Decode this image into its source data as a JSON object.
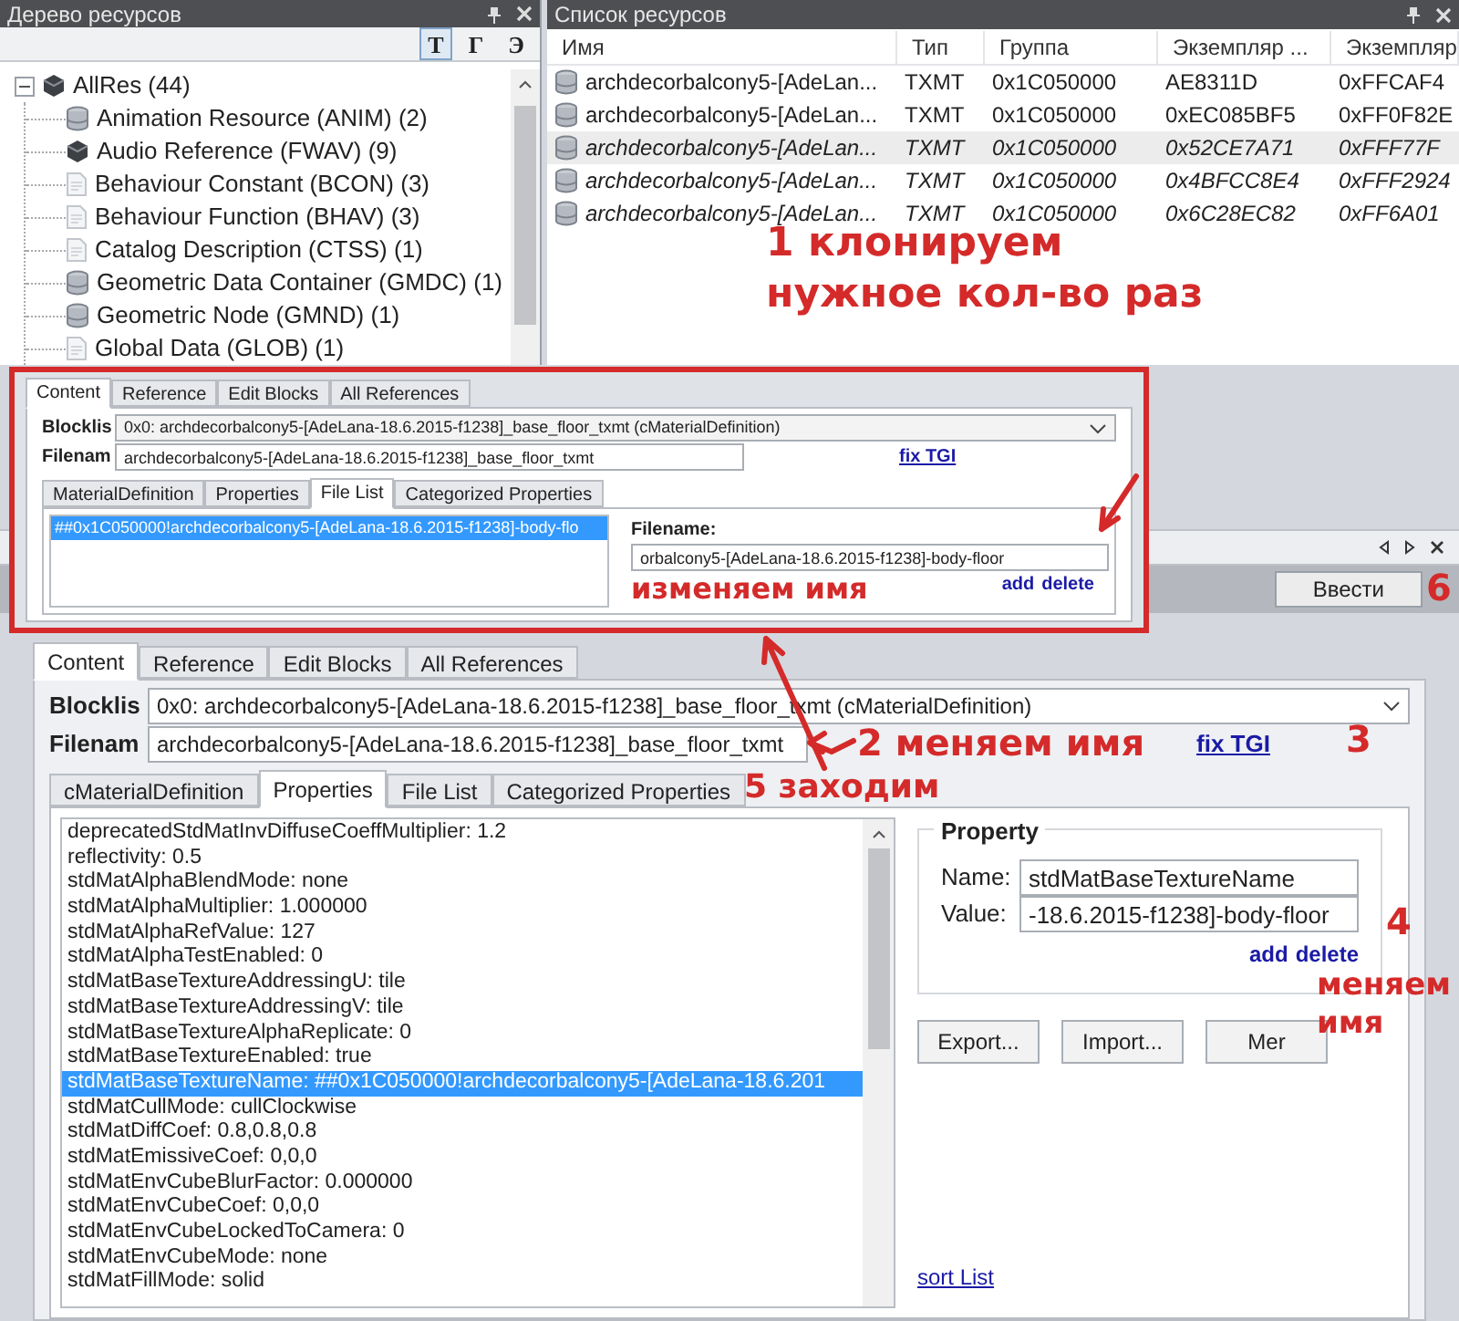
{
  "resource_tree": {
    "title": "Дерево ресурсов",
    "toolbar": [
      {
        "label": "Т",
        "selected": true
      },
      {
        "label": "Г",
        "selected": false
      },
      {
        "label": "Э",
        "selected": false
      }
    ],
    "items": [
      {
        "label": "AllRes (44)",
        "kind": "cube",
        "expanded": true,
        "children": [
          {
            "label": "Animation Resource (ANIM) (2)",
            "kind": "database"
          },
          {
            "label": "Audio Reference (FWAV) (9)",
            "kind": "cube"
          },
          {
            "label": "Behaviour Constant (BCON) (3)",
            "kind": "document"
          },
          {
            "label": "Behaviour Function (BHAV) (3)",
            "kind": "document"
          },
          {
            "label": "Catalog Description (CTSS) (1)",
            "kind": "document"
          },
          {
            "label": "Geometric Data Container (GMDC) (1)",
            "kind": "database"
          },
          {
            "label": "Geometric Node (GMND) (1)",
            "kind": "database"
          },
          {
            "label": "Global Data (GLOB) (1)",
            "kind": "document"
          }
        ]
      }
    ]
  },
  "resource_list": {
    "title": "Список ресурсов",
    "columns": [
      "Имя",
      "Тип",
      "Группа",
      "Экземпляр ...",
      "Экземпляр"
    ],
    "rows": [
      {
        "cells": [
          "archdecorbalcony5-[AdeLan...",
          "TXMT",
          "0x1C050000",
          "AE8311D",
          "0xFFCAF4"
        ],
        "selected": false,
        "cloned": false
      },
      {
        "cells": [
          "archdecorbalcony5-[AdeLan...",
          "TXMT",
          "0x1C050000",
          "0xEC085BF5",
          "0xFF0F82E"
        ],
        "selected": false,
        "cloned": false
      },
      {
        "cells": [
          "archdecorbalcony5-[AdeLan...",
          "TXMT",
          "0x1C050000",
          "0x52CE7A71",
          "0xFFF77F"
        ],
        "selected": true,
        "cloned": true
      },
      {
        "cells": [
          "archdecorbalcony5-[AdeLan...",
          "TXMT",
          "0x1C050000",
          "0x4BFCC8E4",
          "0xFFF2924"
        ],
        "selected": false,
        "cloned": true
      },
      {
        "cells": [
          "archdecorbalcony5-[AdeLan...",
          "TXMT",
          "0x1C050000",
          "0x6C28EC82",
          "0xFF6A01"
        ],
        "selected": false,
        "cloned": true
      }
    ]
  },
  "inset": {
    "tabs": [
      {
        "label": "Content",
        "selected": true
      },
      {
        "label": "Reference",
        "selected": false
      },
      {
        "label": "Edit Blocks",
        "selected": false
      },
      {
        "label": "All References",
        "selected": false
      }
    ],
    "blocklist_label": "Blocklis",
    "blocklist_value": "0x0: archdecorbalcony5-[AdeLana-18.6.2015-f1238]_base_floor_txmt (cMaterialDefinition)",
    "filename_label": "Filenam",
    "filename_value": "archdecorbalcony5-[AdeLana-18.6.2015-f1238]_base_floor_txmt",
    "fix_link": "fix TGI",
    "subtabs": [
      {
        "label": "MaterialDefinition",
        "selected": false
      },
      {
        "label": "Properties",
        "selected": false
      },
      {
        "label": "File List",
        "selected": true
      },
      {
        "label": "Categorized Properties",
        "selected": false
      }
    ],
    "files": [
      {
        "label": "##0x1C050000!archdecorbalcony5-[AdeLana-18.6.2015-f1238]-body-flo",
        "selected": true
      }
    ],
    "file_label": "Filename:",
    "file_value": "orbalcony5-[AdeLana-18.6.2015-f1238]-body-floor",
    "add": "add",
    "delete": "delete"
  },
  "editor": {
    "apply_button": "Ввести",
    "tabs": [
      {
        "label": "Content",
        "selected": true
      },
      {
        "label": "Reference",
        "selected": false
      },
      {
        "label": "Edit Blocks",
        "selected": false
      },
      {
        "label": "All References",
        "selected": false
      }
    ],
    "blocklist_label": "Blocklis",
    "blocklist_value": "0x0: archdecorbalcony5-[AdeLana-18.6.2015-f1238]_base_floor_txmt (cMaterialDefinition)",
    "filename_label": "Filenam",
    "filename_value": "archdecorbalcony5-[AdeLana-18.6.2015-f1238]_base_floor_txmt",
    "fix_link": "fix TGI",
    "subtabs": [
      {
        "label": "cMaterialDefinition",
        "selected": false
      },
      {
        "label": "Properties",
        "selected": true
      },
      {
        "label": "File List",
        "selected": false
      },
      {
        "label": "Categorized Properties",
        "selected": false
      }
    ],
    "properties": [
      {
        "text": "deprecatedStdMatInvDiffuseCoeffMultiplier: 1.2",
        "selected": false
      },
      {
        "text": "reflectivity: 0.5",
        "selected": false
      },
      {
        "text": "stdMatAlphaBlendMode: none",
        "selected": false
      },
      {
        "text": "stdMatAlphaMultiplier: 1.000000",
        "selected": false
      },
      {
        "text": "stdMatAlphaRefValue: 127",
        "selected": false
      },
      {
        "text": "stdMatAlphaTestEnabled: 0",
        "selected": false
      },
      {
        "text": "stdMatBaseTextureAddressingU: tile",
        "selected": false
      },
      {
        "text": "stdMatBaseTextureAddressingV: tile",
        "selected": false
      },
      {
        "text": "stdMatBaseTextureAlphaReplicate: 0",
        "selected": false
      },
      {
        "text": "stdMatBaseTextureEnabled: true",
        "selected": false
      },
      {
        "text": "stdMatBaseTextureName: ##0x1C050000!archdecorbalcony5-[AdeLana-18.6.201",
        "selected": true
      },
      {
        "text": "stdMatCullMode: cullClockwise",
        "selected": false
      },
      {
        "text": "stdMatDiffCoef: 0.8,0.8,0.8",
        "selected": false
      },
      {
        "text": "stdMatEmissiveCoef: 0,0,0",
        "selected": false
      },
      {
        "text": "stdMatEnvCubeBlurFactor: 0.000000",
        "selected": false
      },
      {
        "text": "stdMatEnvCubeCoef: 0,0,0",
        "selected": false
      },
      {
        "text": "stdMatEnvCubeLockedToCamera: 0",
        "selected": false
      },
      {
        "text": "stdMatEnvCubeMode: none",
        "selected": false
      },
      {
        "text": "stdMatFillMode: solid",
        "selected": false
      }
    ],
    "property": {
      "title": "Property",
      "name_label": "Name:",
      "name_value": "stdMatBaseTextureName",
      "value_label": "Value:",
      "value_value": "-18.6.2015-f1238]-body-floor",
      "add": "add",
      "delete": "delete"
    },
    "buttons": [
      "Export...",
      "Import...",
      "Mer"
    ],
    "sort_link": "sort List"
  },
  "annotations": [
    {
      "lines": [
        "1 клонируем",
        "нужное кол-во раз"
      ]
    },
    {
      "lines": [
        "изменяем имя"
      ]
    },
    {
      "lines": [
        "6"
      ]
    },
    {
      "lines": [
        "2 меняем имя"
      ]
    },
    {
      "lines": [
        "3"
      ]
    },
    {
      "lines": [
        "5 заходим"
      ]
    },
    {
      "lines": [
        "4"
      ]
    },
    {
      "lines": [
        "меняем",
        "имя"
      ]
    }
  ]
}
